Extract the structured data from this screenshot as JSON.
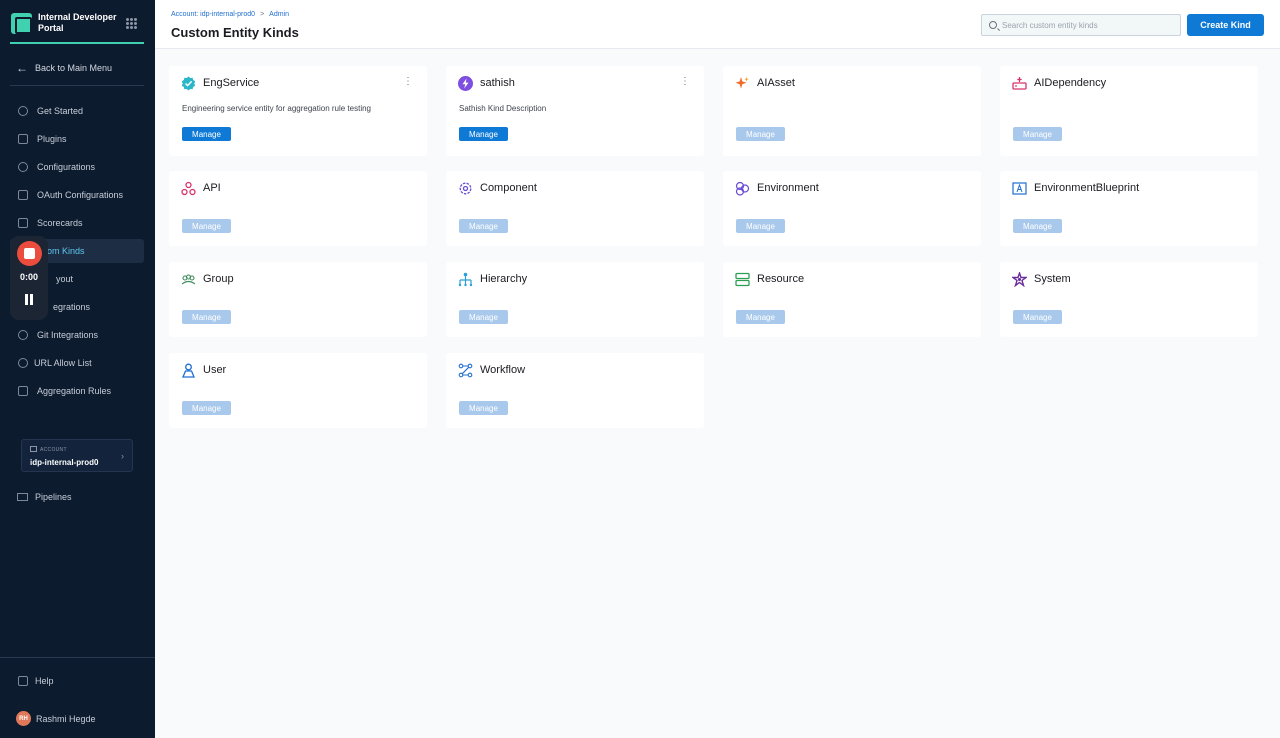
{
  "sidebar": {
    "brand": "Internal Developer Portal",
    "back_label": "Back to Main Menu",
    "items": [
      {
        "label": "Get Started"
      },
      {
        "label": "Plugins"
      },
      {
        "label": "Configurations"
      },
      {
        "label": "OAuth Configurations"
      },
      {
        "label": "Scorecards"
      },
      {
        "label": "Custom Kinds",
        "shown": "stom Kinds",
        "active": true
      },
      {
        "label": "Layout",
        "shown": "yout"
      },
      {
        "label": "Integrations",
        "shown": "egrations"
      },
      {
        "label": "Git Integrations"
      },
      {
        "label": "URL Allow List"
      },
      {
        "label": "Aggregation Rules"
      }
    ],
    "account": {
      "label": "ACCOUNT",
      "name": "idp-internal-prod0"
    },
    "pipelines_label": "Pipelines",
    "help_label": "Help",
    "user": {
      "initials": "RH",
      "name": "Rashmi Hegde"
    }
  },
  "recorder": {
    "time": "0:00"
  },
  "header": {
    "breadcrumb": {
      "account": "Account: idp-internal-prod0",
      "sep": ">",
      "admin": "Admin"
    },
    "title": "Custom Entity Kinds",
    "search_placeholder": "Search custom entity kinds",
    "create_label": "Create Kind"
  },
  "cards": [
    {
      "title": "EngService",
      "description": "Engineering service entity for aggregation rule testing",
      "manage": "Manage",
      "menu": "⋮",
      "icon": "verified-badge-icon"
    },
    {
      "title": "sathish",
      "description": "Sathish Kind Description",
      "manage": "Manage",
      "menu": "⋮",
      "icon": "lightning-icon"
    },
    {
      "title": "AIAsset",
      "manage": "Manage",
      "icon": "sparkle-icon"
    },
    {
      "title": "AIDependency",
      "manage": "Manage",
      "icon": "dependency-icon"
    },
    {
      "title": "API",
      "manage": "Manage",
      "icon": "api-icon"
    },
    {
      "title": "Component",
      "manage": "Manage",
      "icon": "component-gear-icon"
    },
    {
      "title": "Environment",
      "manage": "Manage",
      "icon": "environment-icon"
    },
    {
      "title": "EnvironmentBlueprint",
      "manage": "Manage",
      "icon": "blueprint-icon"
    },
    {
      "title": "Group",
      "manage": "Manage",
      "icon": "group-icon"
    },
    {
      "title": "Hierarchy",
      "manage": "Manage",
      "icon": "hierarchy-icon"
    },
    {
      "title": "Resource",
      "manage": "Manage",
      "icon": "resource-icon"
    },
    {
      "title": "System",
      "manage": "Manage",
      "icon": "system-icon"
    },
    {
      "title": "User",
      "manage": "Manage",
      "icon": "user-icon"
    },
    {
      "title": "Workflow",
      "manage": "Manage",
      "icon": "workflow-icon"
    }
  ],
  "colors": {
    "primary": "#0f7ad6",
    "primary_disabled": "#a9c9ec",
    "sidebar": "#0d1b2e",
    "accent": "#3fd1b0"
  }
}
